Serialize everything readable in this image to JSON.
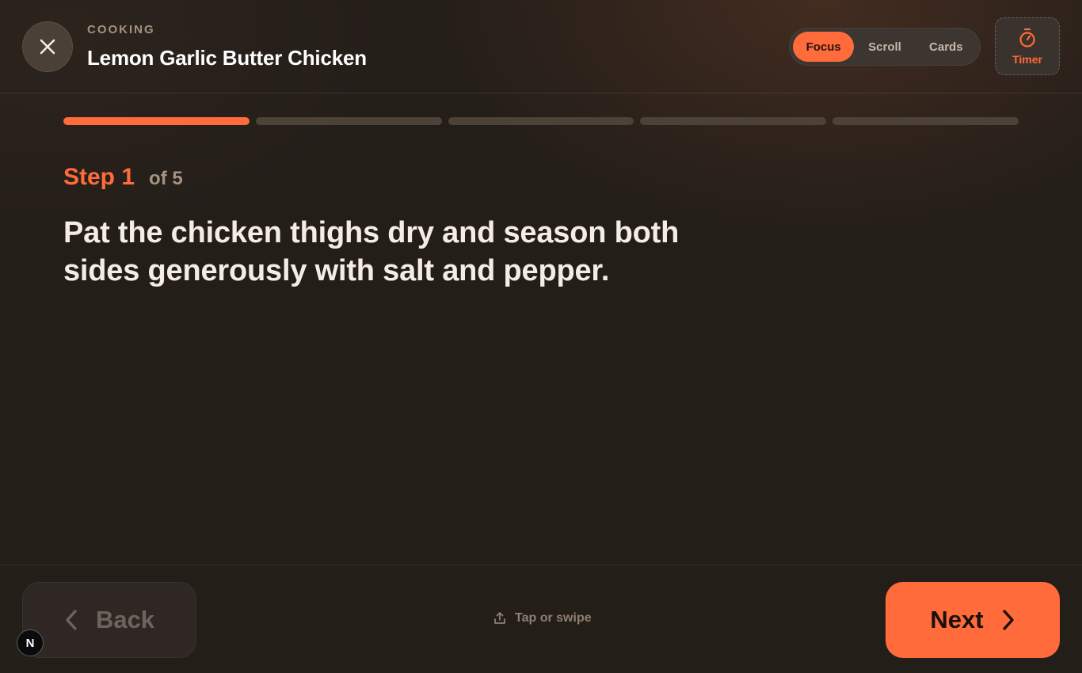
{
  "header": {
    "category": "COOKING",
    "title": "Lemon Garlic Butter Chicken",
    "modes": [
      {
        "label": "Focus",
        "active": true
      },
      {
        "label": "Scroll",
        "active": false
      },
      {
        "label": "Cards",
        "active": false
      }
    ],
    "timer_label": "Timer",
    "close_icon": "close-icon",
    "timer_icon": "stopwatch-icon"
  },
  "progress": {
    "current_step": 1,
    "total_steps": 5
  },
  "step": {
    "label": "Step 1",
    "of_label": "of 5",
    "instruction": "Pat the chicken thighs dry and season both sides generously with salt and pepper."
  },
  "footer": {
    "back_label": "Back",
    "hint_label": "Tap or swipe",
    "next_label": "Next",
    "badge_label": "N"
  },
  "colors": {
    "accent": "#ff6b3a",
    "background": "#241e19",
    "muted": "#a49383"
  }
}
